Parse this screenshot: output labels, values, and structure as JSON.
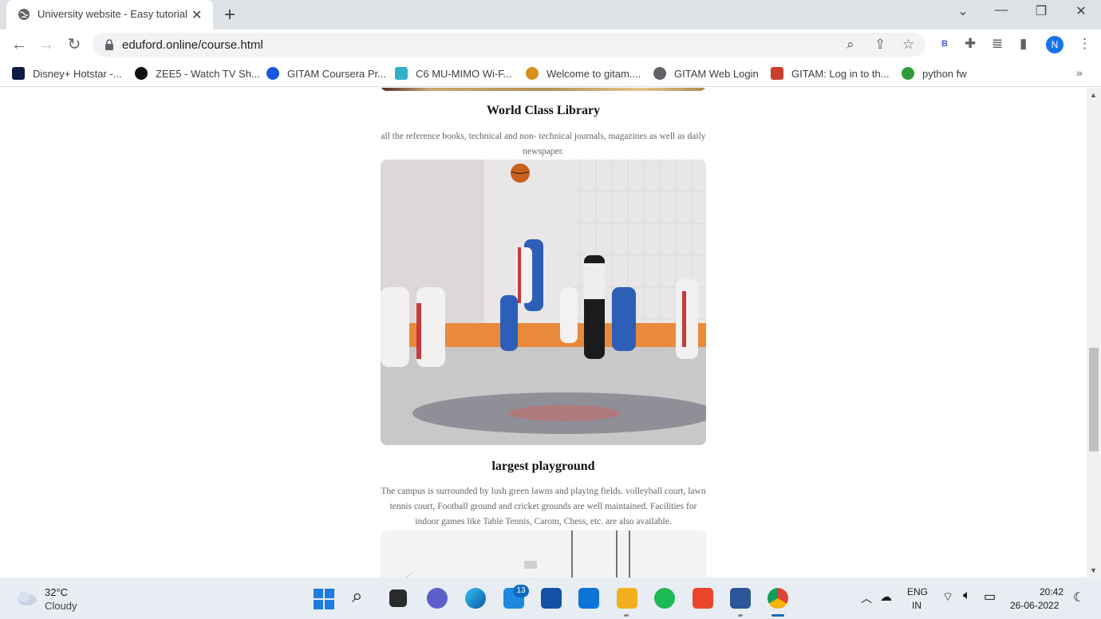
{
  "browser": {
    "tab_title": "University website - Easy tutorial",
    "new_tab": "+",
    "url": "eduford.online/course.html",
    "profile_initial": "N",
    "extension_badge": "B"
  },
  "bookmarks": [
    {
      "label": "Disney+ Hotstar -...",
      "color": "#0c1b45"
    },
    {
      "label": "ZEE5 - Watch TV Sh...",
      "color": "#111111"
    },
    {
      "label": "GITAM Coursera Pr...",
      "color": "#1a56db"
    },
    {
      "label": "C6 MU-MIMO Wi-F...",
      "color": "#33b0c9"
    },
    {
      "label": "Welcome to gitam....",
      "color": "#d98f1d"
    },
    {
      "label": "GITAM Web Login",
      "color": "#5f6368"
    },
    {
      "label": "GITAM: Log in to th...",
      "color": "#c7412c"
    },
    {
      "label": "python fw",
      "color": "#2e9a3b"
    }
  ],
  "content": {
    "section1": {
      "title": "World Class Library",
      "text": "all the reference books, technical and non- technical journals, magazines as well as daily newspaper."
    },
    "section2": {
      "title": "largest playground",
      "text": "The campus is surrounded by lush green lawns and playing fields. volleyball court, lawn tennis court, Football ground and cricket grounds are well maintained. Facilities for indoor games like Table Tennis, Carom, Chess, etc. are also available."
    }
  },
  "taskbar": {
    "temperature": "32°C",
    "weather": "Cloudy",
    "mail_badge": "13",
    "language_top": "ENG",
    "language_bottom": "IN",
    "time": "20:42",
    "date": "26-06-2022"
  },
  "colors": {
    "tabbar": "#dee1e6",
    "accent": "#1a73e8",
    "taskbar": "#e8ecf3"
  }
}
